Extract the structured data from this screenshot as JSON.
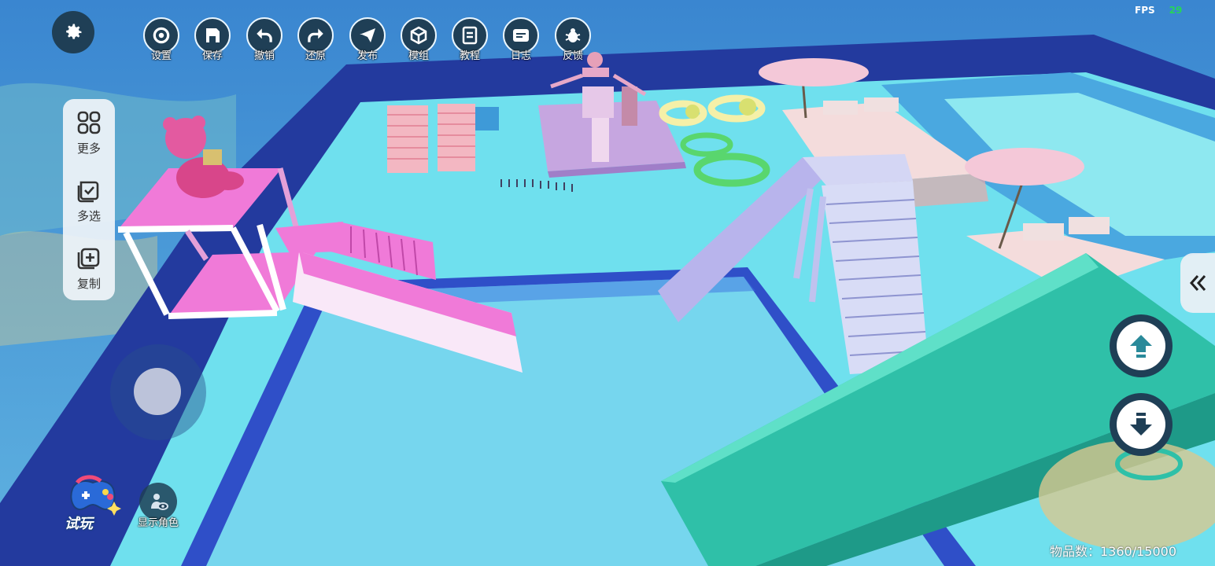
{
  "toolbar": {
    "items": [
      {
        "label": "设置",
        "icon": "gear-icon"
      },
      {
        "label": "保存",
        "icon": "save-icon"
      },
      {
        "label": "撤销",
        "icon": "undo-icon"
      },
      {
        "label": "还原",
        "icon": "redo-icon"
      },
      {
        "label": "发布",
        "icon": "send-icon"
      },
      {
        "label": "模组",
        "icon": "cube-icon"
      },
      {
        "label": "教程",
        "icon": "book-icon"
      },
      {
        "label": "日志",
        "icon": "log-icon"
      },
      {
        "label": "反馈",
        "icon": "bug-icon"
      }
    ]
  },
  "side_panel": {
    "items": [
      {
        "label": "更多",
        "icon": "grid-icon"
      },
      {
        "label": "多选",
        "icon": "multi-select-icon"
      },
      {
        "label": "复制",
        "icon": "copy-icon"
      }
    ]
  },
  "fps": {
    "label": "FPS",
    "value": "29"
  },
  "bottom": {
    "play_test_label": "试玩",
    "show_character_label": "显示角色",
    "item_count": "物品数：1360/15000"
  },
  "colors": {
    "button_dark": "#1f3f56",
    "fps_green": "#26d45a",
    "pool_water": "#7fe3f0",
    "pool_wall": "#233a9e",
    "slide_teal": "#2fc0a8",
    "pink": "#f07ad8"
  }
}
